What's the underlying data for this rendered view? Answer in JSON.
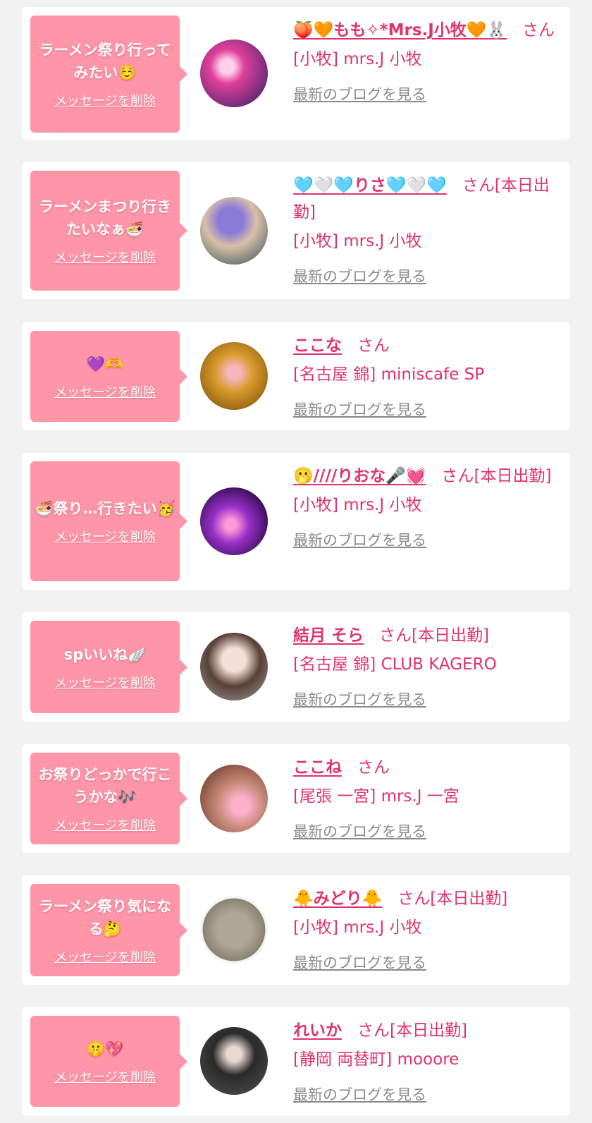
{
  "entries": [
    {
      "message": "ラーメン祭り行ってみたい☺️",
      "delete_label": "メッセージを削除",
      "avatar": "avatar-photo",
      "name": "🍑🧡もも✧*Mrs.J小牧🧡🐰",
      "suffix": "さん",
      "shop": "[小牧] mrs.J 小牧",
      "blog_label": "最新のブログを見る"
    },
    {
      "message": "ラーメンまつり行きたいなぁ🍜",
      "delete_label": "メッセージを削除",
      "avatar": "avatar-photo",
      "name": "🩵🤍🩵りさ🩵🤍🩵",
      "suffix": "さん[本日出勤]",
      "shop": "[小牧] mrs.J 小牧",
      "blog_label": "最新のブログを見る"
    },
    {
      "message": "💜🫶",
      "delete_label": "メッセージを削除",
      "avatar": "avatar-photo",
      "name": "ここな",
      "suffix": "さん",
      "shop": "[名古屋 錦] miniscafe SP",
      "blog_label": "最新のブログを見る"
    },
    {
      "message": "🍜祭り…行きたい🥳",
      "delete_label": "メッセージを削除",
      "avatar": "avatar-photo",
      "name": "🫢////りおな🎤💓",
      "suffix": "さん[本日出勤]",
      "shop": "[小牧] mrs.J 小牧",
      "blog_label": "最新のブログを見る"
    },
    {
      "message": "spいいね🪽",
      "delete_label": "メッセージを削除",
      "avatar": "avatar-photo",
      "name": "結月 そら",
      "suffix": "さん[本日出勤]",
      "shop": "[名古屋 錦] CLUB KAGERO",
      "blog_label": "最新のブログを見る"
    },
    {
      "message": "お祭りどっかで行こうかな🎶",
      "delete_label": "メッセージを削除",
      "avatar": "avatar-photo",
      "name": "ここね",
      "suffix": "さん",
      "shop": "[尾張 一宮] mrs.J 一宮",
      "blog_label": "最新のブログを見る"
    },
    {
      "message": "ラーメン祭り気になる🤔",
      "delete_label": "メッセージを削除",
      "avatar": "avatar-photo",
      "name": "🐥みどり🐥",
      "suffix": "さん[本日出勤]",
      "shop": "[小牧] mrs.J 小牧",
      "blog_label": "最新のブログを見る"
    },
    {
      "message": "🤫💖",
      "delete_label": "メッセージを削除",
      "avatar": "avatar-photo",
      "name": "れいか",
      "suffix": "さん[本日出勤]",
      "shop": "[静岡 両替町] mooore",
      "blog_label": "最新のブログを見る"
    }
  ]
}
